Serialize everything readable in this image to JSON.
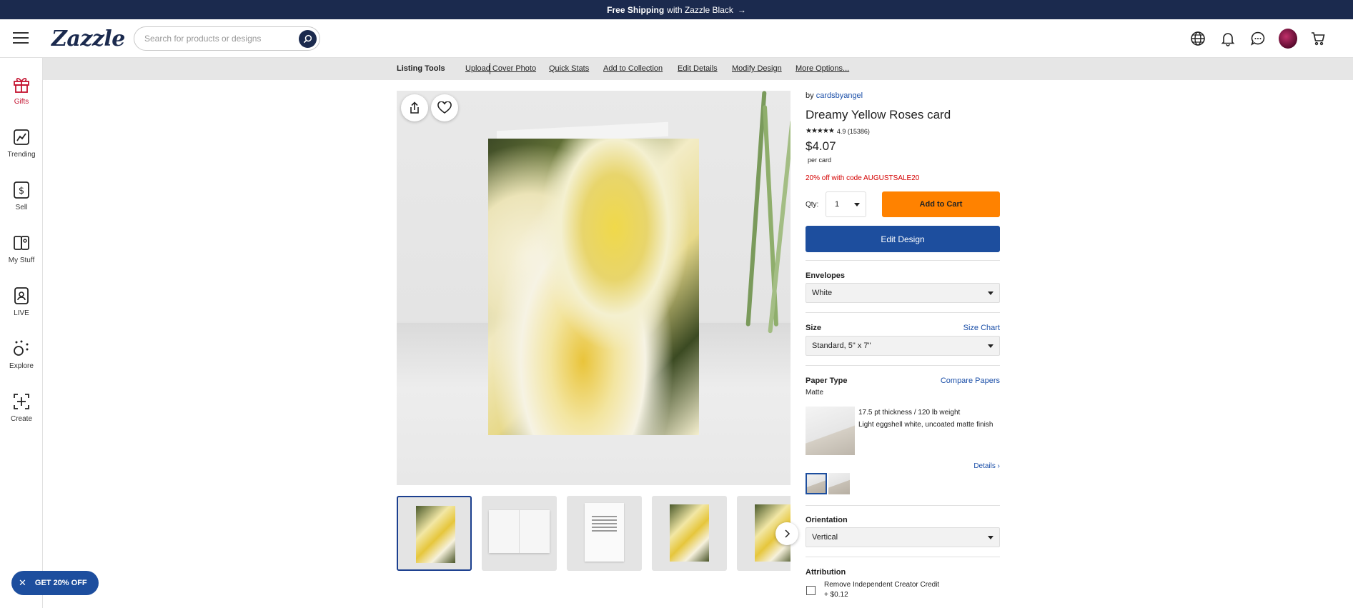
{
  "promo_bar": {
    "bold": "Free Shipping",
    "text": "with Zazzle Black",
    "arrow": "→"
  },
  "header": {
    "logo": "Zazzle",
    "search_placeholder": "Search for products or designs",
    "icons": [
      "globe-icon",
      "bell-icon",
      "chat-icon",
      "avatar",
      "cart-icon"
    ]
  },
  "subnav": {
    "title": "Listing Tools",
    "links": [
      "Upload Cover Photo",
      "Quick Stats",
      "Add to Collection",
      "Edit Details",
      "Modify Design",
      "More Options..."
    ]
  },
  "rail": {
    "items": [
      {
        "label": "Gifts",
        "icon": "gift-icon"
      },
      {
        "label": "Trending",
        "icon": "trending-icon"
      },
      {
        "label": "Sell",
        "icon": "dollar-icon"
      },
      {
        "label": "My Stuff",
        "icon": "mystuff-icon"
      },
      {
        "label": "LIVE",
        "icon": "live-icon"
      },
      {
        "label": "Explore",
        "icon": "explore-icon"
      },
      {
        "label": "Create",
        "icon": "create-icon"
      }
    ]
  },
  "product": {
    "by_prefix": "by",
    "seller": "cardsbyangel",
    "title": "Dreamy Yellow Roses card",
    "stars": "★★★★★",
    "rating": "4.9 (15386)",
    "price": "$4.07",
    "per": "per card",
    "promo": "20% off with code AUGUSTSALE20",
    "qty_label": "Qty:",
    "qty_value": "1",
    "add_to_cart": "Add to Cart",
    "edit_design": "Edit Design"
  },
  "options": {
    "envelopes": {
      "label": "Envelopes",
      "value": "White"
    },
    "size": {
      "label": "Size",
      "link": "Size Chart",
      "value": "Standard, 5\" x 7\""
    },
    "paper": {
      "label": "Paper Type",
      "link": "Compare Papers",
      "value": "Matte",
      "line1": "17.5 pt thickness / 120 lb weight",
      "line2": "Light eggshell white, uncoated matte finish",
      "details": "Details ›"
    },
    "orientation": {
      "label": "Orientation",
      "value": "Vertical"
    },
    "attribution": {
      "label": "Attribution",
      "line1": "Remove Independent Creator Credit",
      "line2": "+ $0.12"
    }
  },
  "coupon": {
    "close": "✕",
    "label": "GET 20% OFF"
  },
  "colors": {
    "navy": "#1b2a4e",
    "orange": "#ff8200",
    "blue": "#1d4e9e",
    "red": "#d40000"
  }
}
